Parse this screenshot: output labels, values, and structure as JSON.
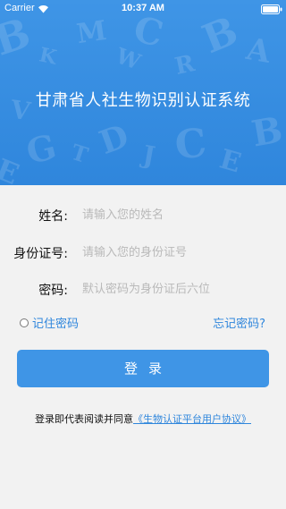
{
  "status_bar": {
    "carrier": "Carrier",
    "time": "10:37 AM",
    "wifi_icon": "wifi-icon",
    "battery_icon": "battery-icon"
  },
  "header": {
    "title": "甘肃省人社生物识别认证系统",
    "background_color": "#3f95e6"
  },
  "form": {
    "name": {
      "label": "姓名:",
      "placeholder": "请输入您的姓名",
      "value": ""
    },
    "id_number": {
      "label": "身份证号:",
      "placeholder": "请输入您的身份证号",
      "value": ""
    },
    "password": {
      "label": "密码:",
      "placeholder": "默认密码为身份证后六位",
      "value": ""
    }
  },
  "remember": {
    "label": "记住密码",
    "checked": false
  },
  "forgot_password": "忘记密码?",
  "login_button": "登录",
  "agreement": {
    "prefix": "登录即代表阅读并同意",
    "link": "《生物认证平台用户协议》"
  },
  "colors": {
    "accent": "#2f86dc",
    "button": "#3f95e6",
    "page_background": "#f2f2f2"
  }
}
